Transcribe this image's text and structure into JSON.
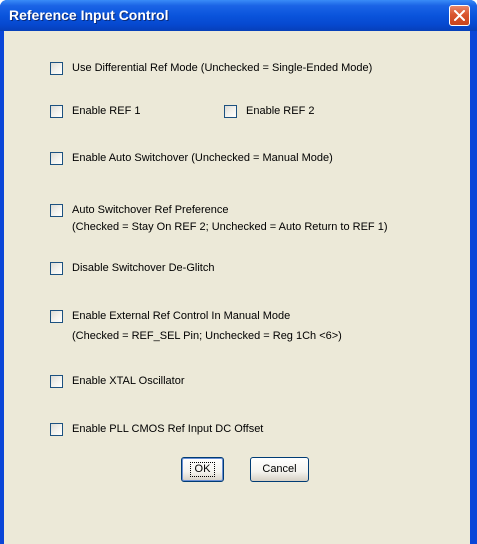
{
  "window": {
    "title": "Reference Input Control"
  },
  "options": [
    {
      "label": "Use Differential Ref Mode (Unchecked = Single-Ended Mode)",
      "checked": false
    },
    {
      "label": "Enable REF 1",
      "checked": false
    },
    {
      "label": "Enable REF 2",
      "checked": false
    },
    {
      "label": "Enable Auto Switchover (Unchecked = Manual Mode)",
      "checked": false
    },
    {
      "label": "Auto Switchover Ref Preference",
      "sub": "(Checked = Stay On REF 2; Unchecked = Auto Return to REF 1)",
      "checked": false
    },
    {
      "label": "Disable Switchover De-Glitch",
      "checked": false
    },
    {
      "label": "Enable External Ref Control In Manual Mode",
      "sub": "(Checked = REF_SEL Pin; Unchecked = Reg 1Ch <6>)",
      "checked": false
    },
    {
      "label": "Enable XTAL Oscillator",
      "checked": false
    },
    {
      "label": "Enable PLL CMOS Ref Input DC Offset",
      "checked": false
    }
  ],
  "buttons": {
    "ok": "OK",
    "cancel": "Cancel"
  },
  "icons": {
    "close": "close-icon"
  },
  "colors": {
    "titlebar": "#0a54dc",
    "dialog_bg": "#ece9d8",
    "close_button": "#d9552f",
    "checkbox_border": "#1c5180"
  }
}
